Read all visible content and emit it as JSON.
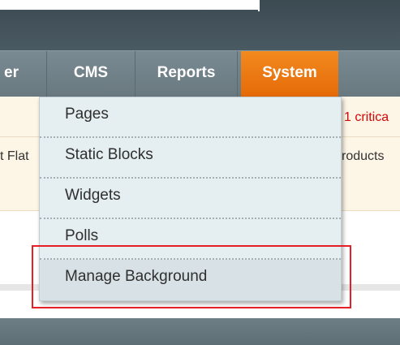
{
  "nav": {
    "items": [
      {
        "label": "er"
      },
      {
        "label": "CMS"
      },
      {
        "label": "Reports"
      },
      {
        "label": "System"
      }
    ]
  },
  "notices": {
    "left_fragment": "t Flat",
    "right_critical": "1 critica",
    "right_products": "roducts"
  },
  "dropdown": {
    "items": [
      {
        "label": "Pages"
      },
      {
        "label": "Static Blocks"
      },
      {
        "label": "Widgets"
      },
      {
        "label": "Polls"
      },
      {
        "label": "Manage Background"
      }
    ]
  },
  "colors": {
    "active_tab": "#e56a09",
    "highlight_border": "#e51f25",
    "critical_text": "#d40707"
  }
}
